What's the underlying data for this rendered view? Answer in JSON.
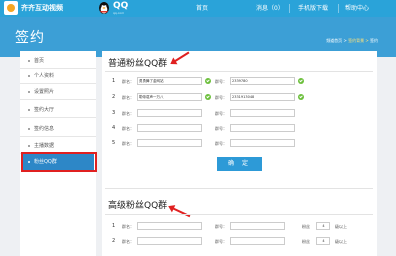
{
  "topbar": {
    "site_name": "齐齐互动视频",
    "qq_label": "QQ",
    "qq_sub": "qq.com",
    "nav_home": "首页",
    "nav_messages": "消息（0）",
    "nav_mobile": "手机版下载",
    "nav_help": "帮助中心"
  },
  "header": {
    "title": "签约",
    "breadcrumb_current": "频道首页 > ",
    "breadcrumb_link": "签约背景 > ",
    "breadcrumb_end": "签约"
  },
  "sidebar": {
    "items": [
      {
        "label": "首页"
      },
      {
        "label": "个人资料"
      },
      {
        "label": "设置照片"
      },
      {
        "label": "签约大厅"
      },
      {
        "label": "签约信息"
      },
      {
        "label": "主播数据"
      },
      {
        "label": "粉丝QQ群"
      }
    ]
  },
  "section1": {
    "title": "普通粉丝QQ群",
    "rows": [
      {
        "num": "1",
        "name_label": "群名：",
        "name": "勇勇舞了金网站",
        "no_label": "群号：",
        "no": "2339780"
      },
      {
        "num": "2",
        "name_label": "群名：",
        "name": "勒帝葛声一万八",
        "no_label": "群号：",
        "no": "2331913048"
      },
      {
        "num": "3",
        "name_label": "群名：",
        "name": "",
        "no_label": "群号：",
        "no": ""
      },
      {
        "num": "4",
        "name_label": "群名：",
        "name": "",
        "no_label": "群号：",
        "no": ""
      },
      {
        "num": "5",
        "name_label": "群名：",
        "name": "",
        "no_label": "群号：",
        "no": ""
      }
    ],
    "confirm_label": "确 定"
  },
  "section2": {
    "title": "高级粉丝QQ群",
    "rows": [
      {
        "num": "1",
        "name_label": "群名：",
        "no_label": "群号：",
        "fan_label": "粉丝",
        "level": "4",
        "level_suffix": "级以上"
      },
      {
        "num": "2",
        "name_label": "群名：",
        "no_label": "群号：",
        "fan_label": "粉丝",
        "level": "4",
        "level_suffix": "级以上"
      }
    ]
  },
  "colors": {
    "topbar": "#2aa3d9",
    "header": "#3c9fd6",
    "active_item": "#2d87c7",
    "highlight": "#e02020",
    "check": "#6cbf3c"
  }
}
